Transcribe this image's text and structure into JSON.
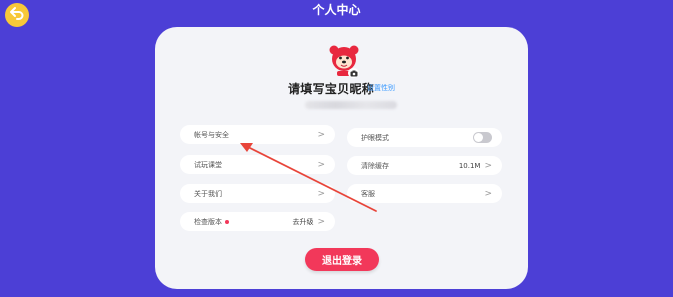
{
  "header": {
    "title": "个人中心",
    "back_icon": "back-arrow-icon"
  },
  "profile": {
    "nickname": "请填写宝贝昵称",
    "gender_link": "设置性别",
    "avatar_icon": "bear-avatar-icon",
    "camera_icon": "camera-icon"
  },
  "left_menu": [
    {
      "label": "帐号与安全",
      "chevron": ">"
    },
    {
      "label": "试玩课堂",
      "chevron": ">"
    },
    {
      "label": "关于我们",
      "chevron": ">"
    },
    {
      "label": "检查版本",
      "value": "去升级",
      "chevron": ">"
    }
  ],
  "right_menu": [
    {
      "label": "护眼模式",
      "toggle_on": false
    },
    {
      "label": "清除缓存",
      "value": "10.1M",
      "chevron": ">"
    },
    {
      "label": "客服",
      "chevron": ">"
    }
  ],
  "logout_label": "退出登录",
  "colors": {
    "background": "#4c3fd6",
    "card": "#f3f4f8",
    "accent_red": "#f2385a",
    "link_blue": "#3d9bff",
    "back_button": "#f7c83a",
    "annotation_arrow": "#e8453a"
  }
}
